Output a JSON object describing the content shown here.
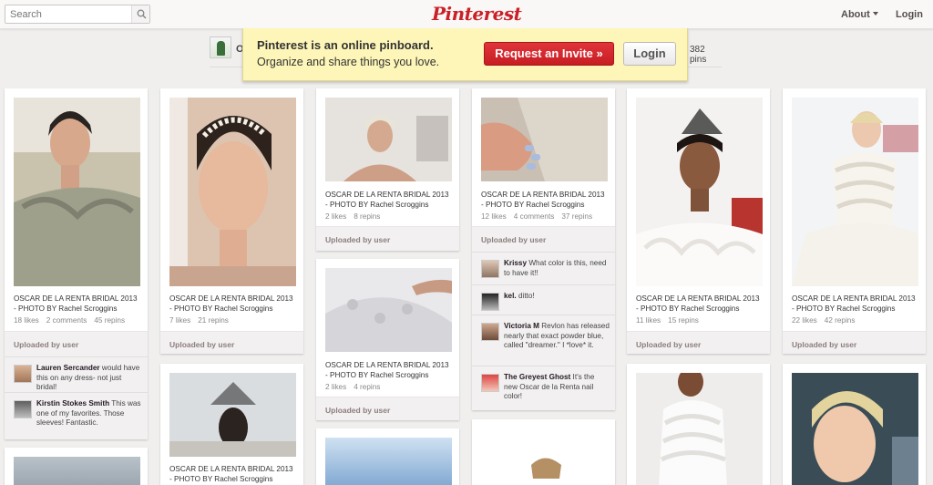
{
  "header": {
    "search_placeholder": "Search",
    "logo": "Pinterest",
    "about": "About",
    "login": "Login"
  },
  "profile": {
    "name": "O",
    "pins": "382 pins"
  },
  "invite": {
    "line1": "Pinterest is an online pinboard.",
    "line2": "Organize and share things you love.",
    "request": "Request an Invite »",
    "login": "Login"
  },
  "colors": {
    "brand": "#cb2027",
    "banner": "#fdf6b8"
  },
  "pins": [
    {
      "desc": "OSCAR DE LA RENTA BRIDAL 2013 - PHOTO BY Rachel Scroggins",
      "likes": "18 likes",
      "comments": "2 comments",
      "repins": "45 repins",
      "uploaded": "Uploaded by user"
    },
    {
      "desc": "OSCAR DE LA RENTA BRIDAL 2013 - PHOTO BY Rachel Scroggins",
      "likes": "7 likes",
      "repins": "21 repins",
      "uploaded": "Uploaded by user"
    },
    {
      "desc": "OSCAR DE LA RENTA BRIDAL 2013 - PHOTO BY Rachel Scroggins",
      "likes": "2 likes",
      "repins": "8 repins",
      "uploaded": "Uploaded by user"
    },
    {
      "desc": "OSCAR DE LA RENTA BRIDAL 2013 - PHOTO BY Rachel Scroggins",
      "likes": "12 likes",
      "comments": "4 comments",
      "repins": "37 repins",
      "uploaded": "Uploaded by user"
    },
    {
      "desc": "OSCAR DE LA RENTA BRIDAL 2013 - PHOTO BY Rachel Scroggins",
      "likes": "11 likes",
      "repins": "15 repins",
      "uploaded": "Uploaded by user"
    },
    {
      "desc": "OSCAR DE LA RENTA BRIDAL 2013 - PHOTO BY Rachel Scroggins",
      "likes": "22 likes",
      "repins": "42 repins",
      "uploaded": "Uploaded by user"
    },
    {
      "desc": "OSCAR DE LA RENTA BRIDAL 2013 - PHOTO BY Rachel Scroggins",
      "likes": "2 likes",
      "repins": "4 repins",
      "uploaded": "Uploaded by user"
    },
    {
      "desc": "OSCAR DE LA RENTA BRIDAL 2013 - PHOTO BY Rachel Scroggins"
    }
  ],
  "comments": {
    "col1": [
      {
        "user": "Lauren Sercander",
        "text": "would have this on any dress- not just bridal!"
      },
      {
        "user": "Kirstin Stokes Smith",
        "text": "This was one of my favorites. Those sleeves! Fantastic."
      }
    ],
    "col4": [
      {
        "user": "Krissy",
        "text": "What color is this, need to have it!!"
      },
      {
        "user": "kel.",
        "text": "ditto!"
      },
      {
        "user": "Victoria M",
        "text": "Revlon has released nearly that exact powder blue, called \"dreamer.\" I *love* it."
      },
      {
        "user": "The Greyest Ghost",
        "text": "It's the new Oscar de la Renta nail color!"
      }
    ]
  }
}
